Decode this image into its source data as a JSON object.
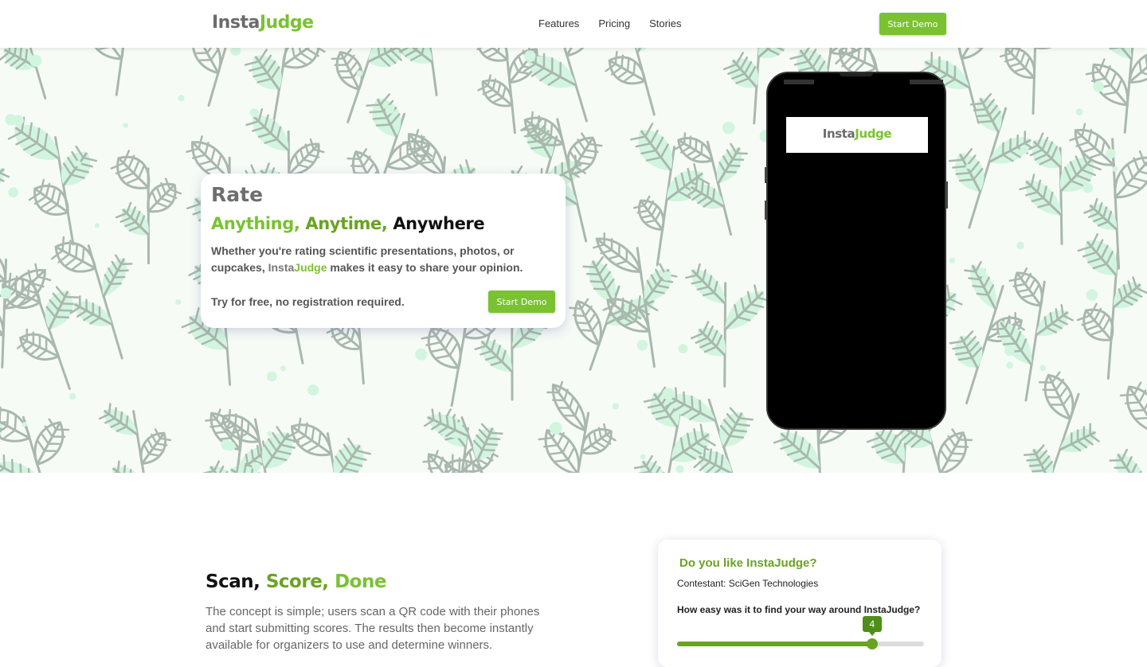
{
  "header": {
    "logo": {
      "insta": "Insta",
      "judge": "Judge"
    },
    "nav": [
      "Features",
      "Pricing",
      "Stories"
    ],
    "cta_label": "Start Demo"
  },
  "hero": {
    "heading": "Rate",
    "tagline": {
      "part1": "Anything,",
      "part2": "Anytime,",
      "part3": "Anywhere"
    },
    "desc_before": "Whether you're rating scientific presentations, photos, or cupcakes, ",
    "desc_insta": "Insta",
    "desc_judge": "Judge",
    "desc_after": " makes it easy to share your opinion.",
    "free_text": "Try for free, no registration required.",
    "cta_label": "Start Demo",
    "phone_logo": {
      "insta": "Insta",
      "judge": "Judge"
    }
  },
  "section2": {
    "title": {
      "part1": "Scan,",
      "part2": "Score,",
      "part3": "Done"
    },
    "body": "The concept is simple; users scan a QR code with their phones and start submitting scores. The results then become instantly available for organizers to use and determine winners."
  },
  "survey": {
    "title": "Do you like InstaJudge?",
    "contestant": "Contestant: SciGen Technologies",
    "question": "How easy was it to find your way around InstaJudge?",
    "slider_value": "4",
    "slider_fraction": 0.79
  },
  "colors": {
    "brand_green": "#7ac231",
    "dark_green": "#6aa321",
    "leaf_mint": "#d2f5df",
    "leaf_vein": "#a9b8ad"
  }
}
